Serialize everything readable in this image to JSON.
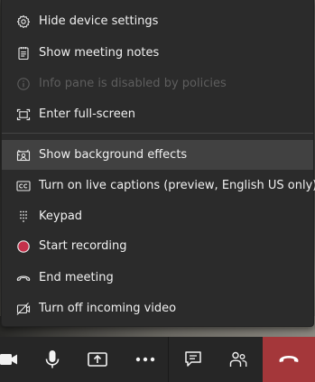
{
  "menu": {
    "items": [
      {
        "label": "Hide device settings",
        "icon": "gear-icon"
      },
      {
        "label": "Show meeting notes",
        "icon": "notes-icon"
      },
      {
        "label": "Info pane is disabled by policies",
        "icon": "info-icon"
      },
      {
        "label": "Enter full-screen",
        "icon": "fullscreen-icon"
      },
      {
        "label": "Show background effects",
        "icon": "background-effects-icon"
      },
      {
        "label": "Turn on live captions (preview, English US only)",
        "icon": "closed-captions-icon"
      },
      {
        "label": "Keypad",
        "icon": "keypad-icon"
      },
      {
        "label": "Start recording",
        "icon": "record-icon"
      },
      {
        "label": "End meeting",
        "icon": "end-meeting-icon"
      },
      {
        "label": "Turn off incoming video",
        "icon": "video-off-icon"
      }
    ]
  },
  "toolbar": {
    "buttons": [
      "camera-icon",
      "microphone-icon",
      "share-screen-icon",
      "more-actions-icon",
      "chat-icon",
      "participants-icon",
      "hang-up-icon"
    ]
  },
  "colors": {
    "menu_bg": "#2b2b2b",
    "hover_bg": "#414141",
    "text": "#f0f0f0",
    "disabled_text": "#5e5e5e",
    "record_red": "#c4314b",
    "hangup_bg": "#a4373a"
  }
}
